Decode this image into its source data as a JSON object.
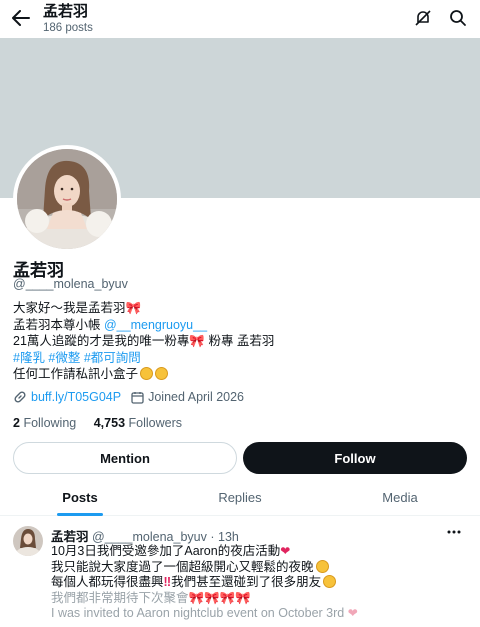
{
  "header": {
    "title": "孟若羽",
    "post_count": "186 posts"
  },
  "profile": {
    "name": "孟若羽",
    "handle": "@____molena_byuv",
    "bio": {
      "line1": "大家好～我是孟若羽🎀",
      "line2_prefix": "孟若羽本尊小帳 ",
      "line2_link": "@__mengruoyu__",
      "line3": "21萬人追蹤的才是我的唯一粉專🎀 粉專 孟若羽",
      "line4_tags": "#隆乳 #微整 #都可詢問",
      "line5": "任何工作請私訊小盒子"
    },
    "link": "buff.ly/T05G04P",
    "joined": "Joined April 2026",
    "following_count": "2",
    "following_label": "Following",
    "followers_count": "4,753",
    "followers_label": "Followers"
  },
  "buttons": {
    "mention": "Mention",
    "follow": "Follow"
  },
  "tabs": [
    {
      "label": "Posts",
      "active": true
    },
    {
      "label": "Replies",
      "active": false
    },
    {
      "label": "Media",
      "active": false
    }
  ],
  "post": {
    "author_name": "孟若羽",
    "author_handle": "@____molena_byuv",
    "separator": "·",
    "time": "13h",
    "line1": "10月3日我們受邀參加了Aaron的夜店活動",
    "line2": "我只能說大家度過了一個超級開心又輕鬆的夜晚",
    "line3a": "每個人都玩得很盡興",
    "line3b": "我們甚至還碰到了很多朋友",
    "line4": "我們都非常期待下次聚會🎀🎀🎀🎀",
    "line5": "I was invited to Aaron nightclub event on October 3rd"
  },
  "icons": {
    "back": "arrow-left-icon",
    "no_notify": "bell-off-icon",
    "search": "search-icon",
    "link": "link-icon",
    "calendar": "calendar-icon",
    "more": "more-dots-icon"
  },
  "colors": {
    "accent": "#1d9bf0",
    "banner": "#cdd6d8",
    "text": "#0f1419",
    "muted": "#536471",
    "follow_bg": "#0f1419"
  }
}
